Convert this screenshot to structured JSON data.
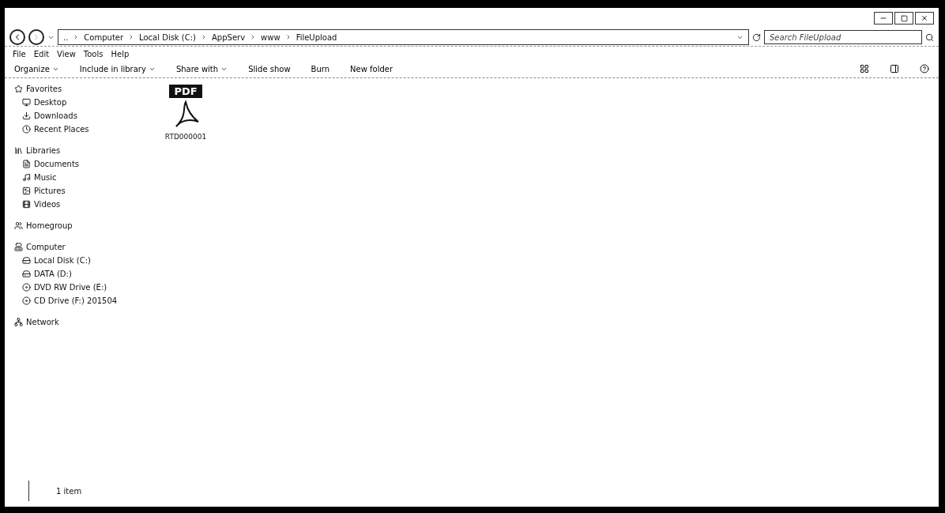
{
  "address": {
    "path": [
      "..",
      "Computer",
      "Local Disk (C:)",
      "AppServ",
      "www",
      "FileUpload"
    ]
  },
  "search": {
    "placeholder": "Search FileUpload"
  },
  "menu": [
    "File",
    "Edit",
    "View",
    "Tools",
    "Help"
  ],
  "toolbar": [
    {
      "label": "Organize",
      "dropdown": true
    },
    {
      "label": "Include in library",
      "dropdown": true
    },
    {
      "label": "Share with",
      "dropdown": true
    },
    {
      "label": "Slide show",
      "dropdown": false
    },
    {
      "label": "Burn",
      "dropdown": false
    },
    {
      "label": "New folder",
      "dropdown": false
    }
  ],
  "sidebar": [
    {
      "label": "Favorites",
      "kind": "star",
      "children": [
        {
          "label": "Desktop",
          "kind": "desktop"
        },
        {
          "label": "Downloads",
          "kind": "download"
        },
        {
          "label": "Recent Places",
          "kind": "recent"
        }
      ]
    },
    {
      "label": "Libraries",
      "kind": "library",
      "children": [
        {
          "label": "Documents",
          "kind": "document"
        },
        {
          "label": "Music",
          "kind": "music"
        },
        {
          "label": "Pictures",
          "kind": "picture"
        },
        {
          "label": "Videos",
          "kind": "video"
        }
      ]
    },
    {
      "label": "Homegroup",
      "kind": "homegroup"
    },
    {
      "label": "Computer",
      "kind": "computer",
      "children": [
        {
          "label": "Local Disk (C:)",
          "kind": "disk"
        },
        {
          "label": "DATA (D:)",
          "kind": "drive"
        },
        {
          "label": "DVD RW Drive (E:)",
          "kind": "dvd"
        },
        {
          "label": "CD Drive (F:) 201504",
          "kind": "cd"
        }
      ]
    },
    {
      "label": "Network",
      "kind": "network"
    }
  ],
  "files": [
    {
      "name": "RTD000001",
      "badge": "PDF"
    }
  ],
  "status_bar": {
    "count": "1 item"
  }
}
